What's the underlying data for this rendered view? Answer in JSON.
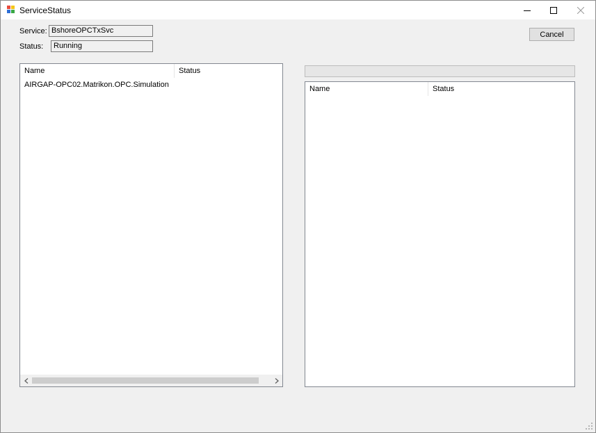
{
  "window": {
    "title": "ServiceStatus",
    "icon": "windows-forms-app-icon"
  },
  "titlebar_controls": {
    "minimize_icon": "minimize-icon",
    "maximize_icon": "maximize-icon",
    "close_icon": "close-icon"
  },
  "service": {
    "label": "Service:",
    "value": "BshoreOPCTxSvc"
  },
  "status": {
    "label": "Status:",
    "value": "Running"
  },
  "cancel_button": {
    "label": "Cancel"
  },
  "left_list": {
    "columns": [
      "Name",
      "Status"
    ],
    "rows": [
      {
        "name": "AIRGAP-OPC02.Matrikon.OPC.Simulation",
        "status": ""
      }
    ]
  },
  "right_list": {
    "columns": [
      "Name",
      "Status"
    ],
    "rows": []
  },
  "progress_bar": {
    "value": 0
  },
  "colors": {
    "window_bg": "#f0f0f0",
    "titlebar_bg": "#ffffff",
    "list_bg": "#ffffff",
    "border": "#828790"
  }
}
